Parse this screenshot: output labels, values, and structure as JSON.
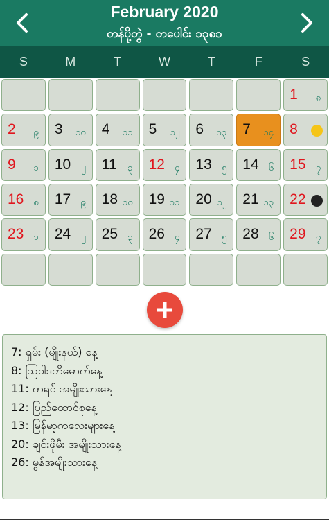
{
  "header": {
    "title": "February 2020",
    "subtitle": "တန်ပို့တွဲ - တပေါင်း ၁၃၈၁"
  },
  "weekdays": [
    "S",
    "M",
    "T",
    "W",
    "T",
    "F",
    "S"
  ],
  "calendar": {
    "cells": [
      {
        "day": "",
        "mm": "",
        "red": false
      },
      {
        "day": "",
        "mm": "",
        "red": false
      },
      {
        "day": "",
        "mm": "",
        "red": false
      },
      {
        "day": "",
        "mm": "",
        "red": false
      },
      {
        "day": "",
        "mm": "",
        "red": false
      },
      {
        "day": "",
        "mm": "",
        "red": false
      },
      {
        "day": "1",
        "mm": "၈",
        "red": true
      },
      {
        "day": "2",
        "mm": "၉",
        "red": true
      },
      {
        "day": "3",
        "mm": "၁၀",
        "red": false
      },
      {
        "day": "4",
        "mm": "၁၁",
        "red": false
      },
      {
        "day": "5",
        "mm": "၁၂",
        "red": false
      },
      {
        "day": "6",
        "mm": "၁၃",
        "red": false
      },
      {
        "day": "7",
        "mm": "၁၄",
        "red": false,
        "today": true
      },
      {
        "day": "8",
        "mm": "",
        "red": true,
        "moon": "full"
      },
      {
        "day": "9",
        "mm": "၁",
        "red": true
      },
      {
        "day": "10",
        "mm": "၂",
        "red": false
      },
      {
        "day": "11",
        "mm": "၃",
        "red": false
      },
      {
        "day": "12",
        "mm": "၄",
        "red": true
      },
      {
        "day": "13",
        "mm": "၅",
        "red": false
      },
      {
        "day": "14",
        "mm": "၆",
        "red": false
      },
      {
        "day": "15",
        "mm": "၇",
        "red": true
      },
      {
        "day": "16",
        "mm": "၈",
        "red": true
      },
      {
        "day": "17",
        "mm": "၉",
        "red": false
      },
      {
        "day": "18",
        "mm": "၁၀",
        "red": false
      },
      {
        "day": "19",
        "mm": "၁၁",
        "red": false
      },
      {
        "day": "20",
        "mm": "၁၂",
        "red": false
      },
      {
        "day": "21",
        "mm": "၁၃",
        "red": false
      },
      {
        "day": "22",
        "mm": "",
        "red": true,
        "moon": "new"
      },
      {
        "day": "23",
        "mm": "၁",
        "red": true
      },
      {
        "day": "24",
        "mm": "၂",
        "red": false
      },
      {
        "day": "25",
        "mm": "၃",
        "red": false
      },
      {
        "day": "26",
        "mm": "၄",
        "red": false
      },
      {
        "day": "27",
        "mm": "၅",
        "red": false
      },
      {
        "day": "28",
        "mm": "၆",
        "red": false
      },
      {
        "day": "29",
        "mm": "၇",
        "red": true
      },
      {
        "day": "",
        "mm": "",
        "red": false
      },
      {
        "day": "",
        "mm": "",
        "red": false
      },
      {
        "day": "",
        "mm": "",
        "red": false
      },
      {
        "day": "",
        "mm": "",
        "red": false
      },
      {
        "day": "",
        "mm": "",
        "red": false
      },
      {
        "day": "",
        "mm": "",
        "red": false
      },
      {
        "day": "",
        "mm": "",
        "red": false
      }
    ]
  },
  "events": [
    "7: ရှမ်း (မျိုးနယ်) နေ့",
    "8: ဩဝါဒတိမောက်နေ့",
    "11: ကရင် အမျိုးသားနေ့",
    "12: ပြည်ထောင်စုနေ့",
    "13: မြန်မာ့ကလေးများနေ့",
    "20: ချင်းဖိုမီး အမျိုးသားနေ့",
    "26: မွန်အမျိုးသားနေ့"
  ],
  "colors": {
    "header": "#1a7a62",
    "weekbar": "#0f5645",
    "today": "#e8901e",
    "holiday_red": "#e0161e",
    "full_moon": "#f5c518",
    "new_moon": "#222222",
    "fab": "#e84a3c"
  },
  "icons": {
    "prev": "chevron-left-icon",
    "next": "chevron-right-icon",
    "add": "plus-icon"
  }
}
